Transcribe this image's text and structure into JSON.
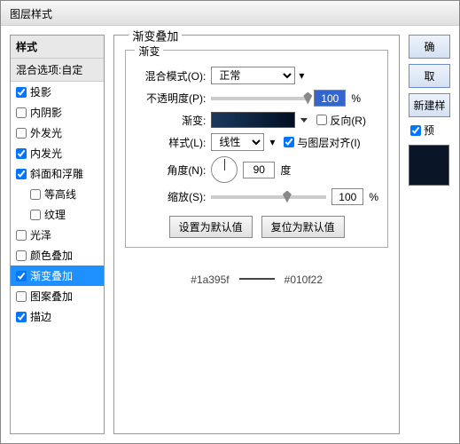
{
  "window_title": "图层样式",
  "styles_panel": {
    "header": "样式",
    "blend": "混合选项:自定",
    "items": [
      {
        "label": "投影",
        "checked": true,
        "indent": false
      },
      {
        "label": "内阴影",
        "checked": false,
        "indent": false
      },
      {
        "label": "外发光",
        "checked": false,
        "indent": false
      },
      {
        "label": "内发光",
        "checked": true,
        "indent": false
      },
      {
        "label": "斜面和浮雕",
        "checked": true,
        "indent": false
      },
      {
        "label": "等高线",
        "checked": false,
        "indent": true
      },
      {
        "label": "纹理",
        "checked": false,
        "indent": true
      },
      {
        "label": "光泽",
        "checked": false,
        "indent": false
      },
      {
        "label": "颜色叠加",
        "checked": false,
        "indent": false
      },
      {
        "label": "渐变叠加",
        "checked": true,
        "indent": false,
        "selected": true
      },
      {
        "label": "图案叠加",
        "checked": false,
        "indent": false
      },
      {
        "label": "描边",
        "checked": true,
        "indent": false
      }
    ]
  },
  "main": {
    "title": "渐变叠加",
    "group": "渐变",
    "blend_mode_label": "混合模式(O):",
    "blend_mode_value": "正常",
    "opacity_label": "不透明度(P):",
    "opacity_value": "100",
    "percent": "%",
    "gradient_label": "渐变:",
    "reverse_label": "反向(R)",
    "style_label": "样式(L):",
    "style_value": "线性",
    "align_label": "与图层对齐(I)",
    "angle_label": "角度(N):",
    "angle_value": "90",
    "degree": "度",
    "scale_label": "缩放(S):",
    "scale_value": "100",
    "set_default": "设置为默认值",
    "reset_default": "复位为默认值",
    "hex1": "#1a395f",
    "hex2": "#010f22"
  },
  "right": {
    "ok": "确",
    "cancel": "取",
    "new_style": "新建样",
    "preview_label": "预"
  }
}
